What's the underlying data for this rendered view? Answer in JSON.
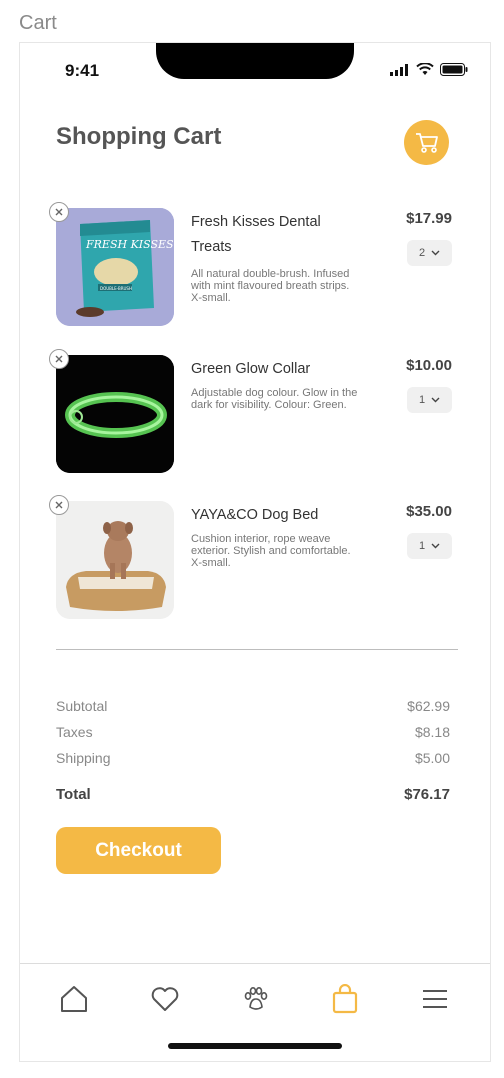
{
  "frame_label": "Cart",
  "status_bar": {
    "time": "9:41"
  },
  "header": {
    "title": "Shopping Cart",
    "cart_icon": "cart-icon"
  },
  "items": [
    {
      "name": "Fresh Kisses Dental Treats",
      "description": "All natural double-brush. Infused with mint flavoured breath strips. X-small.",
      "price": "$17.99",
      "quantity": "2",
      "package_text": "FRESH KISSES",
      "package_subtext": "DOUBLE-BRUSH"
    },
    {
      "name": "Green Glow Collar",
      "description": "Adjustable dog colour. Glow in the dark for visibility. Colour: Green.",
      "price": "$10.00",
      "quantity": "1"
    },
    {
      "name": "YAYA&CO Dog Bed",
      "description": "Cushion interior, rope weave exterior. Stylish and comfortable. X-small.",
      "price": "$35.00",
      "quantity": "1"
    }
  ],
  "summary": {
    "subtotal_label": "Subtotal",
    "subtotal": "$62.99",
    "taxes_label": "Taxes",
    "taxes": "$8.18",
    "shipping_label": "Shipping",
    "shipping": "$5.00",
    "total_label": "Total",
    "total": "$76.17"
  },
  "checkout_label": "Checkout",
  "tabs": [
    "home-icon",
    "heart-icon",
    "paw-icon",
    "bag-icon",
    "menu-icon"
  ],
  "colors": {
    "accent": "#f4b945",
    "text": "#444444",
    "muted": "#888888"
  }
}
